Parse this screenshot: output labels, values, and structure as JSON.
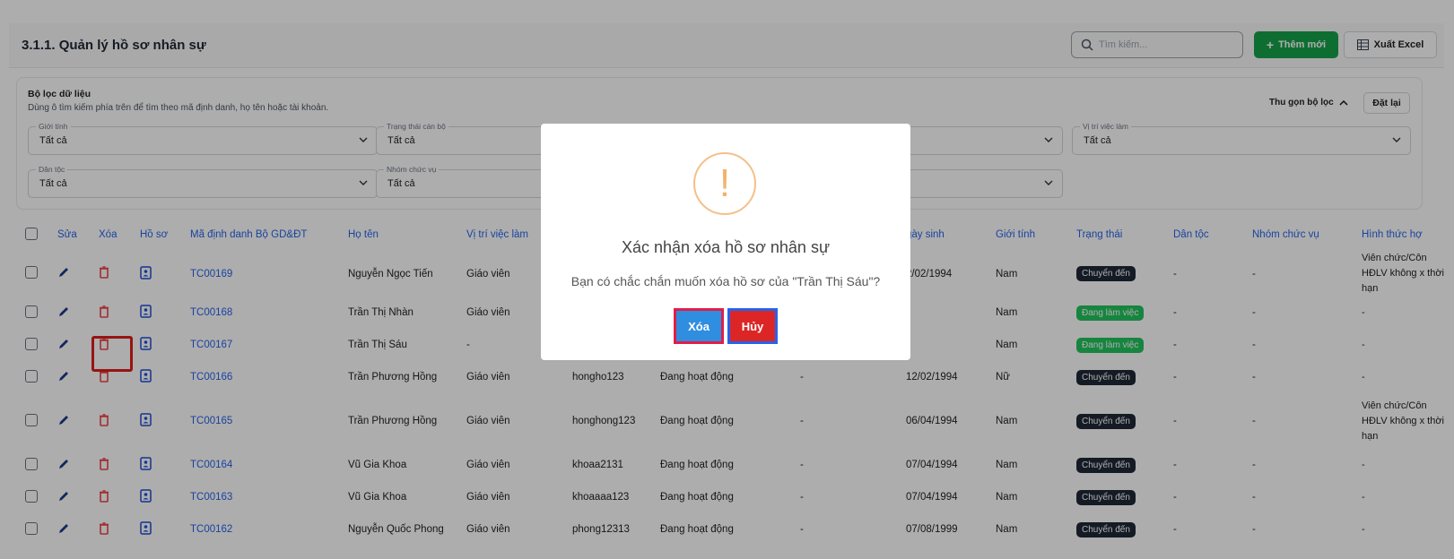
{
  "header": {
    "title": "3.1.1. Quản lý hồ sơ nhân sự",
    "search_placeholder": "Tìm kiếm...",
    "add_label": "Thêm mới",
    "excel_label": "Xuất Excel"
  },
  "filter": {
    "title": "Bộ lọc dữ liệu",
    "description": "Dùng ô tìm kiếm phía trên để tìm theo mã định danh, họ tên hoặc tài khoản.",
    "collapse_label": "Thu gọn bộ lọc",
    "reset_label": "Đặt lại",
    "fields": {
      "gender": {
        "label": "Giới tính",
        "value": "Tất cả"
      },
      "staff_status": {
        "label": "Trạng thái cán bộ",
        "value": "Tất cả"
      },
      "position": {
        "label": "Vị trí việc làm",
        "value": "Tất cả"
      },
      "ethnicity": {
        "label": "Dân tộc",
        "value": "Tất cả"
      },
      "role_group": {
        "label": "Nhóm chức vụ",
        "value": "Tất cả"
      }
    }
  },
  "table": {
    "headers": {
      "edit": "Sửa",
      "delete": "Xóa",
      "profile": "Hồ sơ",
      "code": "Mã định danh Bộ GD&ĐT",
      "name": "Họ tên",
      "position": "Vị trí việc làm",
      "dob": "gày sinh",
      "gender": "Giới tính",
      "status": "Trạng thái",
      "ethnicity": "Dân tộc",
      "role_group": "Nhóm chức vụ",
      "contract": "Hình thức hợ"
    },
    "rows": [
      {
        "code": "TC00169",
        "name": "Nguyễn Ngọc Tiến",
        "position": "Giáo viên",
        "account": "",
        "acc_status": "",
        "extra": "",
        "dob": "2/02/1994",
        "gender": "Nam",
        "status": "Chuyển đến",
        "ethnicity": "-",
        "role_group": "-",
        "contract": "Viên chức/Côn HĐLV không x thời hạn"
      },
      {
        "code": "TC00168",
        "name": "Trần Thị Nhàn",
        "position": "Giáo viên",
        "account": "",
        "acc_status": "",
        "extra": "",
        "dob": "",
        "gender": "Nam",
        "status": "Đang làm việc",
        "ethnicity": "-",
        "role_group": "-",
        "contract": "-"
      },
      {
        "code": "TC00167",
        "name": "Trần Thị Sáu",
        "position": "-",
        "account": "",
        "acc_status": "",
        "extra": "",
        "dob": "",
        "gender": "Nam",
        "status": "Đang làm việc",
        "ethnicity": "-",
        "role_group": "-",
        "contract": "-"
      },
      {
        "code": "TC00166",
        "name": "Trần Phương Hồng",
        "position": "Giáo viên",
        "account": "hongho123",
        "acc_status": "Đang hoạt động",
        "extra": "-",
        "dob": "12/02/1994",
        "gender": "Nữ",
        "status": "Chuyển đến",
        "ethnicity": "-",
        "role_group": "-",
        "contract": "-"
      },
      {
        "code": "TC00165",
        "name": "Trần Phương Hồng",
        "position": "Giáo viên",
        "account": "honghong123",
        "acc_status": "Đang hoạt động",
        "extra": "-",
        "dob": "06/04/1994",
        "gender": "Nam",
        "status": "Chuyển đến",
        "ethnicity": "-",
        "role_group": "-",
        "contract": "Viên chức/Côn HĐLV không x thời hạn"
      },
      {
        "code": "TC00164",
        "name": "Vũ Gia Khoa",
        "position": "Giáo viên",
        "account": "khoaa2131",
        "acc_status": "Đang hoạt động",
        "extra": "-",
        "dob": "07/04/1994",
        "gender": "Nam",
        "status": "Chuyển đến",
        "ethnicity": "-",
        "role_group": "-",
        "contract": "-"
      },
      {
        "code": "TC00163",
        "name": "Vũ Gia Khoa",
        "position": "Giáo viên",
        "account": "khoaaaa123",
        "acc_status": "Đang hoạt động",
        "extra": "-",
        "dob": "07/04/1994",
        "gender": "Nam",
        "status": "Chuyển đến",
        "ethnicity": "-",
        "role_group": "-",
        "contract": "-"
      },
      {
        "code": "TC00162",
        "name": "Nguyễn Quốc Phong",
        "position": "Giáo viên",
        "account": "phong12313",
        "acc_status": "Đang hoạt động",
        "extra": "-",
        "dob": "07/08/1999",
        "gender": "Nam",
        "status": "Chuyển đến",
        "ethnicity": "-",
        "role_group": "-",
        "contract": "-"
      }
    ]
  },
  "modal": {
    "icon": "!",
    "title": "Xác nhận xóa hồ sơ nhân sự",
    "message": "Bạn có chắc chắn muốn xóa hồ sơ của \"Trần Thị Sáu\"?",
    "confirm_label": "Xóa",
    "cancel_label": "Hủy"
  },
  "colors": {
    "accent": "#2563eb",
    "add": "#16a34a",
    "delete_icon": "#ef4444",
    "warning": "#f4b26a"
  }
}
